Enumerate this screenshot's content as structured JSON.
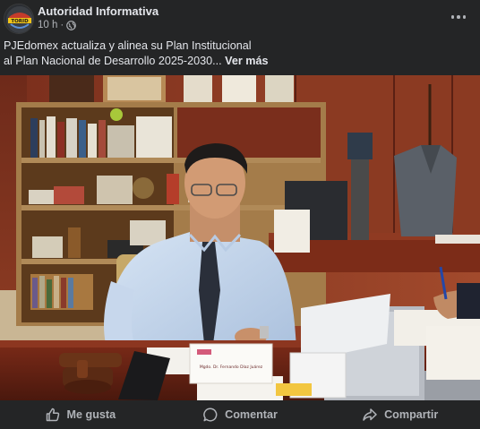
{
  "post": {
    "author": "Autoridad Informativa",
    "avatar_icon": "news-logo-avatar",
    "time": "10 h",
    "separator": "·",
    "audience_icon": "globe-icon",
    "caption_line_1": "PJEdomex actualiza y alinea su Plan Institucional",
    "caption_line_2": "al Plan Nacional de Desarrollo 2025-2030...",
    "see_more": "Ver más"
  },
  "photo": {
    "description_icon": "meeting-photo",
    "nameplate_text": "Mgdo. Dr. Fernando Díaz Juárez"
  },
  "actions": {
    "like": "Me gusta",
    "comment": "Comentar",
    "share": "Compartir"
  },
  "colors": {
    "background": "#242526",
    "text_primary": "#e4e6eb",
    "text_secondary": "#b0b3b8"
  }
}
